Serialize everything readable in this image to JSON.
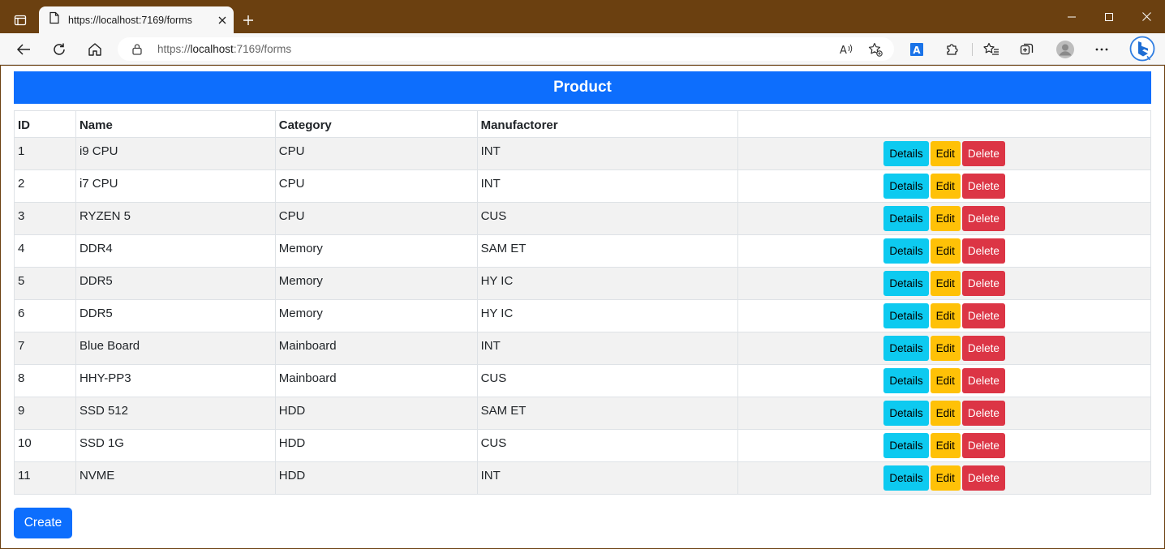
{
  "browser": {
    "tab_title": "https://localhost:7169/forms",
    "url_prefix": "https://",
    "url_host": "localhost",
    "url_rest": ":7169/forms",
    "read_aloud_label": "A"
  },
  "page": {
    "banner_title": "Product",
    "columns": [
      "ID",
      "Name",
      "Category",
      "Manufactorer",
      ""
    ],
    "rows": [
      {
        "id": "1",
        "name": "i9 CPU",
        "category": "CPU",
        "manufacturer": "INT"
      },
      {
        "id": "2",
        "name": "i7 CPU",
        "category": "CPU",
        "manufacturer": "INT"
      },
      {
        "id": "3",
        "name": "RYZEN 5",
        "category": "CPU",
        "manufacturer": "CUS"
      },
      {
        "id": "4",
        "name": "DDR4",
        "category": "Memory",
        "manufacturer": "SAM ET"
      },
      {
        "id": "5",
        "name": "DDR5",
        "category": "Memory",
        "manufacturer": "HY IC"
      },
      {
        "id": "6",
        "name": "DDR5",
        "category": "Memory",
        "manufacturer": "HY IC"
      },
      {
        "id": "7",
        "name": "Blue Board",
        "category": "Mainboard",
        "manufacturer": "INT"
      },
      {
        "id": "8",
        "name": "HHY-PP3",
        "category": "Mainboard",
        "manufacturer": "CUS"
      },
      {
        "id": "9",
        "name": "SSD 512",
        "category": "HDD",
        "manufacturer": "SAM ET"
      },
      {
        "id": "10",
        "name": "SSD 1G",
        "category": "HDD",
        "manufacturer": "CUS"
      },
      {
        "id": "11",
        "name": "NVME",
        "category": "HDD",
        "manufacturer": "INT"
      }
    ],
    "actions": {
      "details_label": "Details",
      "edit_label": "Edit",
      "delete_label": "Delete"
    },
    "create_label": "Create"
  },
  "colors": {
    "primary": "#0d6efd",
    "info": "#0dcaf0",
    "warning": "#ffc107",
    "danger": "#dc3545",
    "titlebar": "#6b4010"
  },
  "icons": {
    "tab_actions": "tab-actions-icon",
    "page": "page-icon",
    "close": "close-icon",
    "new_tab": "plus-icon",
    "back": "back-arrow-icon",
    "refresh": "refresh-icon",
    "home": "home-icon",
    "lock": "lock-icon",
    "read_aloud": "read-aloud-icon",
    "add_favorite": "star-plus-icon",
    "translate": "translate-icon",
    "extensions": "puzzle-icon",
    "favorites": "favorites-icon",
    "collections": "collections-icon",
    "profile": "avatar-icon",
    "more": "ellipsis-icon",
    "copilot": "bing-icon"
  }
}
